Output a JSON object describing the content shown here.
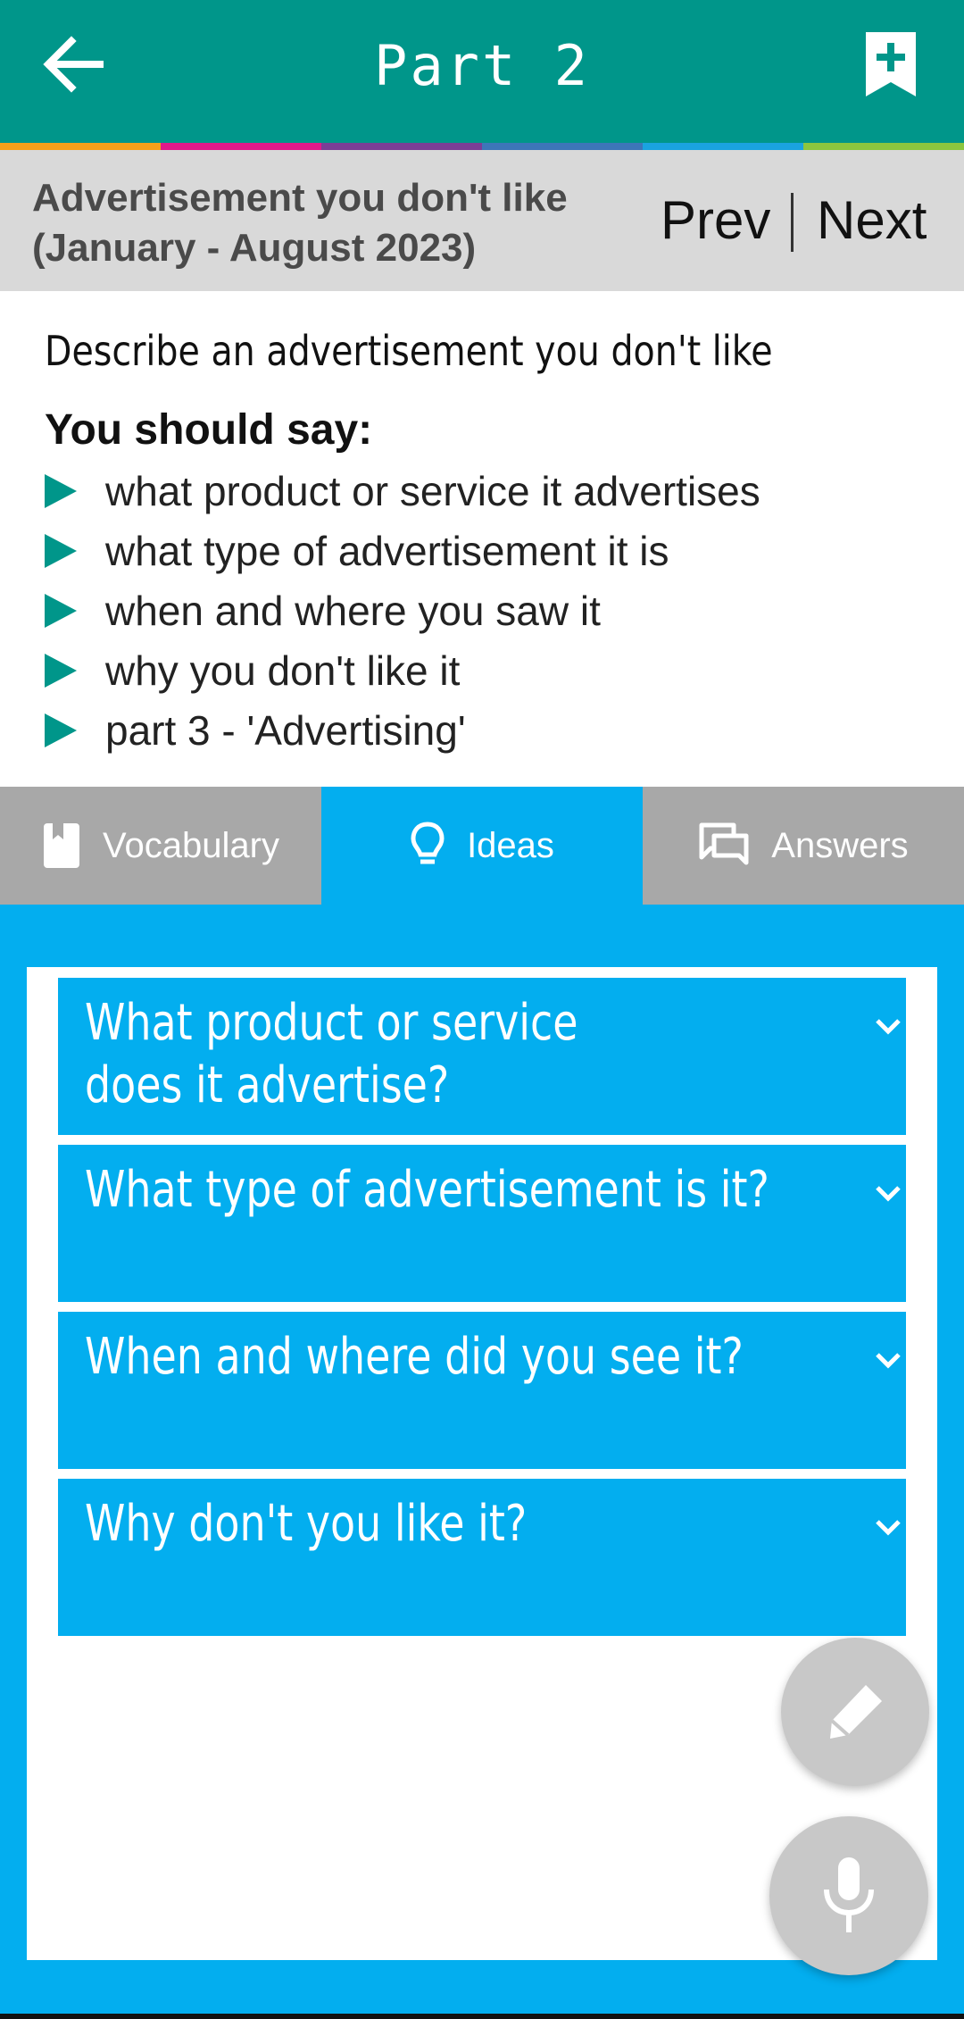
{
  "appbar": {
    "title": "Part 2",
    "back_icon": "arrow-left-icon",
    "bookmark_icon": "bookmark-add-icon",
    "background": "#00968a"
  },
  "stripe_colors": [
    "#f5a01a",
    "#e0198a",
    "#7b3e96",
    "#3d76b9",
    "#1aa3e0",
    "#8cc63f"
  ],
  "topic": {
    "title": "Advertisement you don't like (January - August 2023)",
    "prev_label": "Prev",
    "next_label": "Next"
  },
  "prompt": {
    "description": "Describe an advertisement you don't like",
    "should_say": "You should say:",
    "points": [
      "what product or service it advertises",
      "what type of advertisement it is",
      "when and where you saw it",
      "why you don't like it",
      "part 3 - 'Advertising'"
    ]
  },
  "tabs": [
    {
      "label": "Vocabulary",
      "icon": "book-icon",
      "active": false
    },
    {
      "label": "Ideas",
      "icon": "lightbulb-icon",
      "active": true
    },
    {
      "label": "Answers",
      "icon": "chat-icon",
      "active": false
    }
  ],
  "questions": [
    {
      "text": "What product or service does it advertise?",
      "icon": "chevron-down-icon"
    },
    {
      "text": "What type of advertisement is it?",
      "icon": "chevron-down-icon"
    },
    {
      "text": "When and where did you see it?",
      "icon": "chevron-down-icon"
    },
    {
      "text": "Why don't you like it?",
      "icon": "chevron-down-icon"
    }
  ],
  "fabs": {
    "edit_icon": "pencil-icon",
    "mic_icon": "microphone-icon"
  },
  "colors": {
    "accent_blue": "#03aeef",
    "teal": "#00968a",
    "inactive_tab": "#a8a8a8"
  }
}
